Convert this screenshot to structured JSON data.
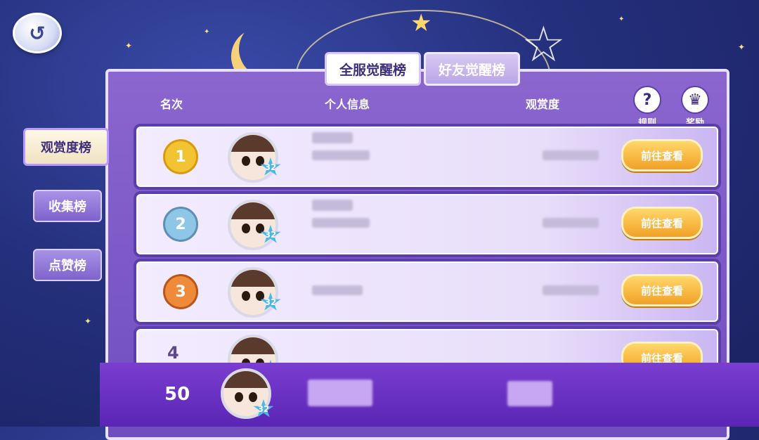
{
  "tabs": [
    {
      "label": "全服觉醒榜",
      "active": true
    },
    {
      "label": "好友觉醒榜",
      "active": false
    }
  ],
  "sidebar": {
    "items": [
      {
        "label": "观赏度榜",
        "active": true
      },
      {
        "label": "收集榜",
        "active": false
      },
      {
        "label": "点赞榜",
        "active": false
      }
    ]
  },
  "headers": {
    "rank": "名次",
    "info": "个人信息",
    "score": "观赏度"
  },
  "icons": {
    "rules_label": "规则",
    "rewards_label": "奖励",
    "rules_glyph": "?",
    "rewards_glyph": "♛",
    "back_glyph": "↺"
  },
  "rows": [
    {
      "rank": "1",
      "level": "32",
      "button": "前往查看",
      "medal_color": "#f2c433"
    },
    {
      "rank": "2",
      "level": "32",
      "button": "前往查看",
      "medal_color": "#8ec6e8"
    },
    {
      "rank": "3",
      "level": "32",
      "button": "前往查看",
      "medal_color": "#ef8a3a"
    },
    {
      "rank": "4",
      "level": "32",
      "button": "前往查看",
      "medal_color": ""
    }
  ],
  "me": {
    "rank": "50",
    "level": "32"
  },
  "colors": {
    "accent": "#6f4ec0",
    "button": "#f2a126"
  }
}
